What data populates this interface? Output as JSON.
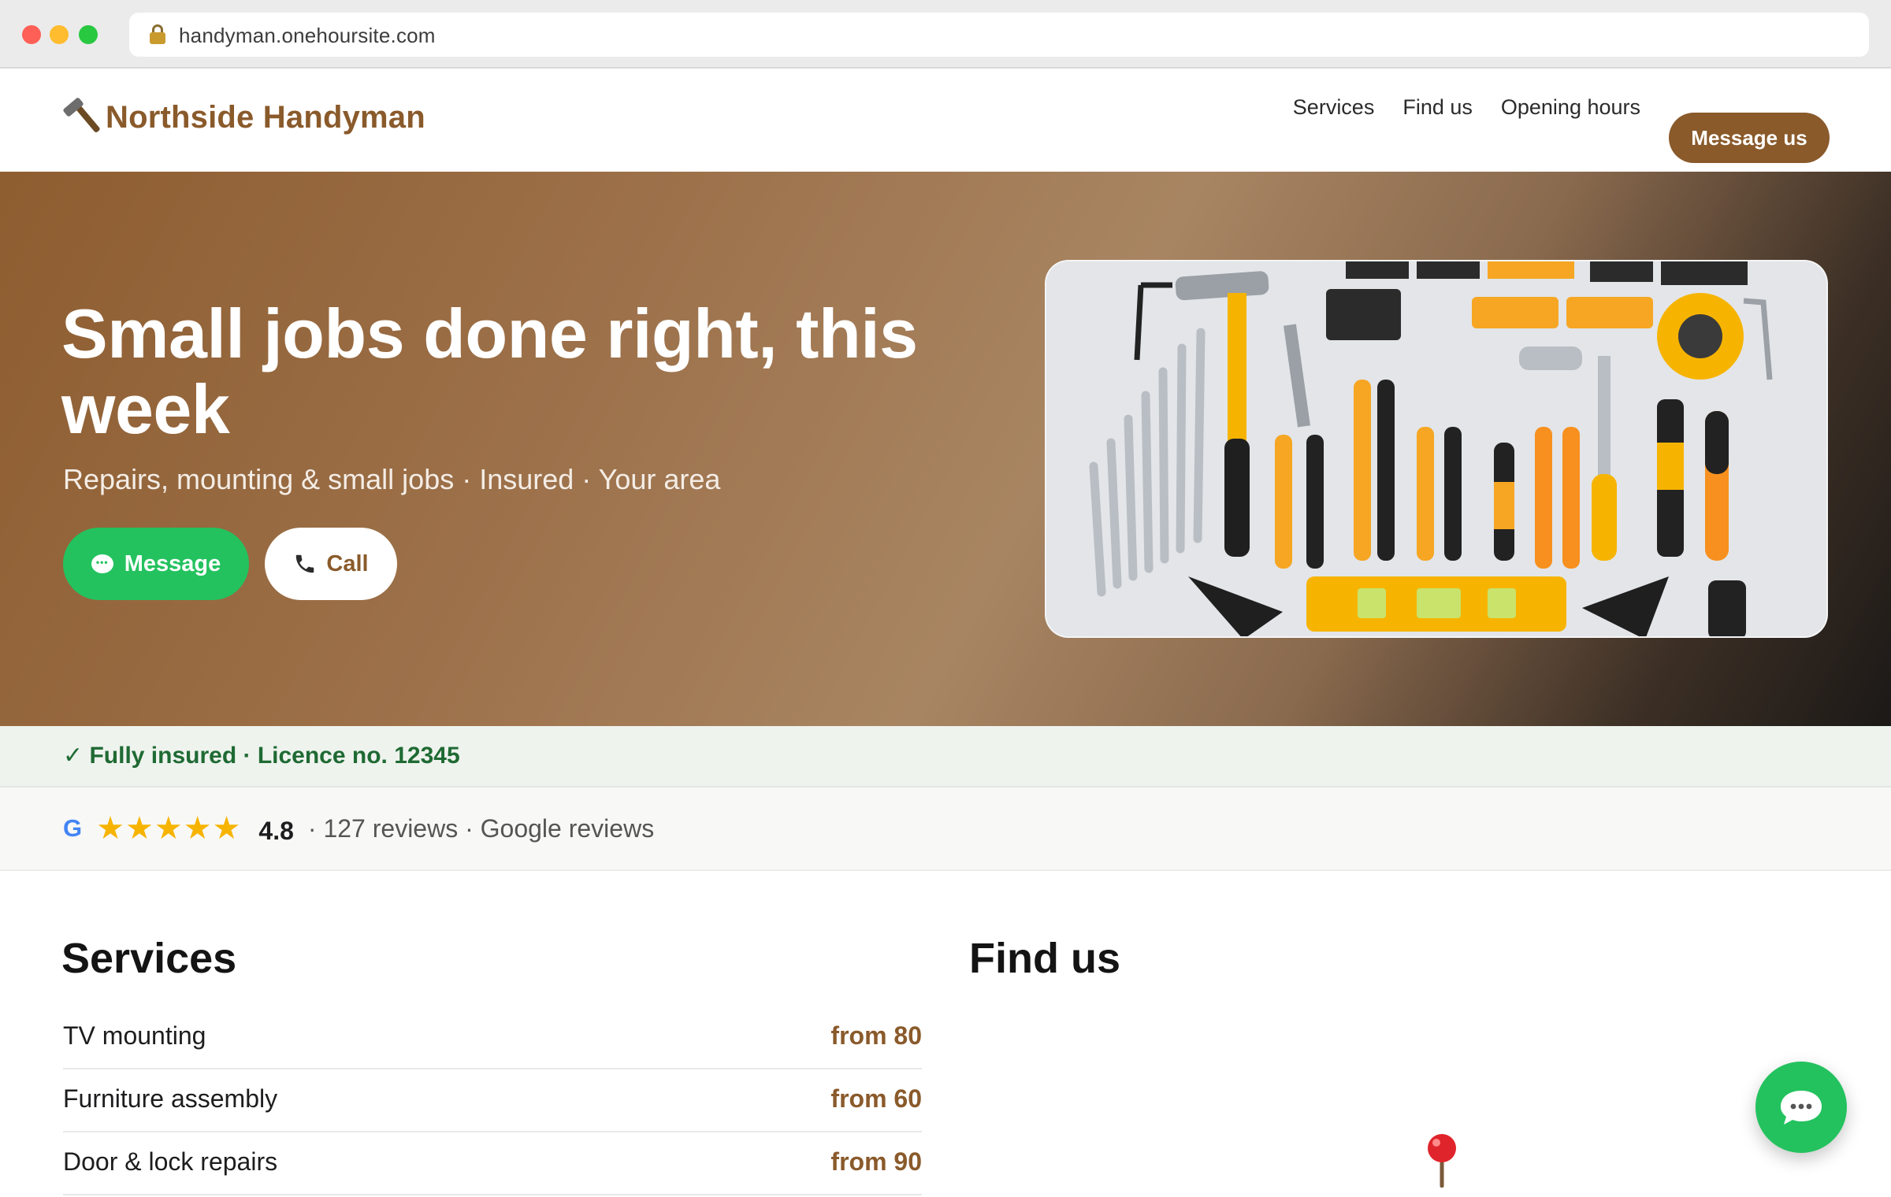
{
  "browser": {
    "url": "handyman.onehoursite.com"
  },
  "site": {
    "brand_name": "Northside Handyman",
    "nav": {
      "links": [
        "Services",
        "Find us",
        "Opening hours"
      ],
      "cta": "Message us"
    }
  },
  "hero": {
    "headline": "Small jobs done right, this week",
    "subhead": "Repairs, mounting & small jobs · Insured · Your area",
    "primary_button": "Message",
    "secondary_button": "Call"
  },
  "trust": {
    "insured_text": "✓ Fully insured · Licence no. 12345"
  },
  "reviews": {
    "source_icon": "G",
    "stars": "★★★★★",
    "rating": 4.8,
    "meta": "· 127 reviews · Google reviews"
  },
  "services": {
    "title": "Services",
    "items": [
      {
        "name": "TV mounting",
        "price": "from 80"
      },
      {
        "name": "Furniture assembly",
        "price": "from 60"
      },
      {
        "name": "Door & lock repairs",
        "price": "from 90"
      }
    ]
  },
  "find_us": {
    "title": "Find us"
  },
  "colors": {
    "brand": "#8a5a2b",
    "whatsapp_green": "#23c25e",
    "insured_green": "#1f6a33",
    "star_gold": "#f6b400"
  },
  "icons": [
    "lock-icon",
    "hammer-icon",
    "chat-bubble-icon",
    "phone-icon",
    "check-icon",
    "google-icon",
    "star-icon",
    "map-pin-icon"
  ]
}
